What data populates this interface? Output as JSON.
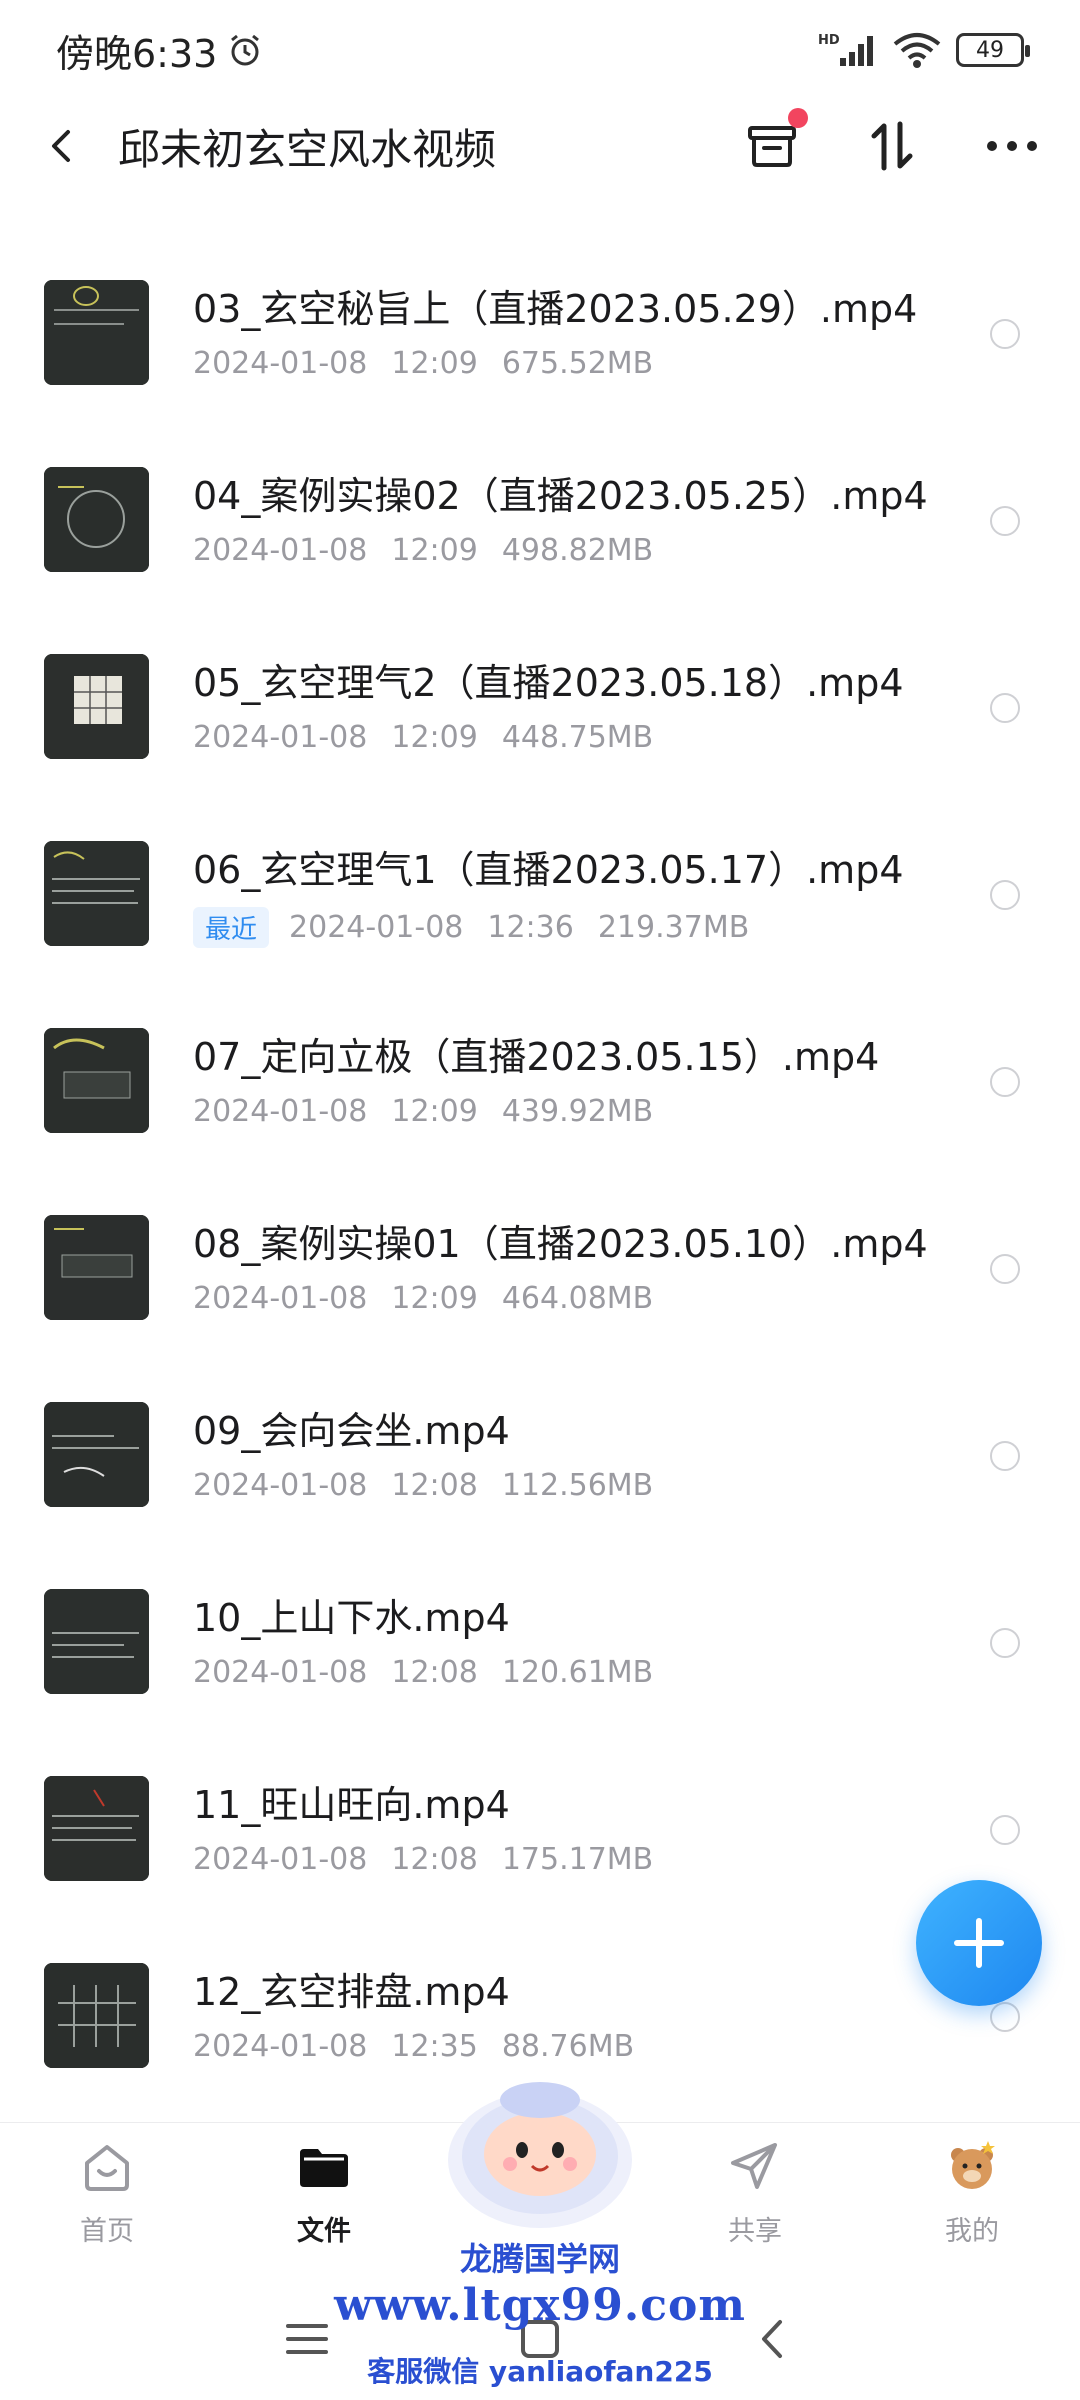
{
  "status_bar": {
    "time": "傍晚6:33",
    "signal_label": "HD",
    "battery": "49"
  },
  "header": {
    "title": "邱未初玄空风水视频"
  },
  "files": [
    {
      "name": "03_玄空秘旨上（直播2023.05.29）.mp4",
      "tag": "",
      "date": "2024-01-08",
      "time": "12:09",
      "size": "675.52MB"
    },
    {
      "name": "04_案例实操02（直播2023.05.25）.mp4",
      "tag": "",
      "date": "2024-01-08",
      "time": "12:09",
      "size": "498.82MB"
    },
    {
      "name": "05_玄空理气2（直播2023.05.18）.mp4",
      "tag": "",
      "date": "2024-01-08",
      "time": "12:09",
      "size": "448.75MB"
    },
    {
      "name": "06_玄空理气1（直播2023.05.17）.mp4",
      "tag": "最近",
      "date": "2024-01-08",
      "time": "12:36",
      "size": "219.37MB"
    },
    {
      "name": "07_定向立极（直播2023.05.15）.mp4",
      "tag": "",
      "date": "2024-01-08",
      "time": "12:09",
      "size": "439.92MB"
    },
    {
      "name": "08_案例实操01（直播2023.05.10）.mp4",
      "tag": "",
      "date": "2024-01-08",
      "time": "12:09",
      "size": "464.08MB"
    },
    {
      "name": "09_会向会坐.mp4",
      "tag": "",
      "date": "2024-01-08",
      "time": "12:08",
      "size": "112.56MB"
    },
    {
      "name": "10_上山下水.mp4",
      "tag": "",
      "date": "2024-01-08",
      "time": "12:08",
      "size": "120.61MB"
    },
    {
      "name": "11_旺山旺向.mp4",
      "tag": "",
      "date": "2024-01-08",
      "time": "12:08",
      "size": "175.17MB"
    },
    {
      "name": "12_玄空排盘.mp4",
      "tag": "",
      "date": "2024-01-08",
      "time": "12:35",
      "size": "88.76MB"
    }
  ],
  "bottom_nav": [
    {
      "label": "首页",
      "icon": "home-icon",
      "active": false
    },
    {
      "label": "文件",
      "icon": "folder-icon",
      "active": true
    },
    {
      "label": "共享",
      "icon": "send-icon",
      "active": false
    },
    {
      "label": "我的",
      "icon": "profile-bear-icon",
      "active": false
    }
  ],
  "watermark": {
    "site_name": "龙腾国学网",
    "url": "www.ltgx99.com",
    "contact": "客服微信 yanliaofan225"
  },
  "colors": {
    "accent": "#2f8cf0",
    "badge": "#f2455f",
    "watermark": "#2a4fd1"
  }
}
